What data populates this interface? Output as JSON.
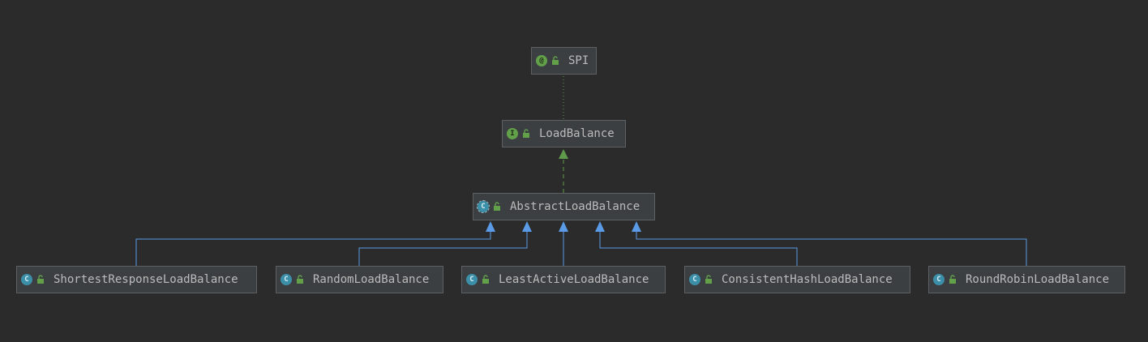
{
  "nodes": {
    "spi": {
      "label": "SPI",
      "kind": "annotation",
      "badge": "@"
    },
    "load_balance": {
      "label": "LoadBalance",
      "kind": "interface",
      "badge": "I"
    },
    "abstract_load_balance": {
      "label": "AbstractLoadBalance",
      "kind": "abstract",
      "badge": "C"
    },
    "shortest_response": {
      "label": "ShortestResponseLoadBalance",
      "kind": "class",
      "badge": "C"
    },
    "random": {
      "label": "RandomLoadBalance",
      "kind": "class",
      "badge": "C"
    },
    "least_active": {
      "label": "LeastActiveLoadBalance",
      "kind": "class",
      "badge": "C"
    },
    "consistent_hash": {
      "label": "ConsistentHashLoadBalance",
      "kind": "class",
      "badge": "C"
    },
    "round_robin": {
      "label": "RoundRobinLoadBalance",
      "kind": "class",
      "badge": "C"
    }
  },
  "edges": [
    {
      "from": "load_balance",
      "to": "spi",
      "type": "annotated-by"
    },
    {
      "from": "abstract_load_balance",
      "to": "load_balance",
      "type": "implements"
    },
    {
      "from": "shortest_response",
      "to": "abstract_load_balance",
      "type": "extends"
    },
    {
      "from": "random",
      "to": "abstract_load_balance",
      "type": "extends"
    },
    {
      "from": "least_active",
      "to": "abstract_load_balance",
      "type": "extends"
    },
    {
      "from": "consistent_hash",
      "to": "abstract_load_balance",
      "type": "extends"
    },
    {
      "from": "round_robin",
      "to": "abstract_load_balance",
      "type": "extends"
    }
  ],
  "colors": {
    "background": "#2b2b2b",
    "extends_line": "#5a9ae6",
    "implements_line": "#5f9a4a",
    "annotation_line": "#5f9a4a"
  }
}
